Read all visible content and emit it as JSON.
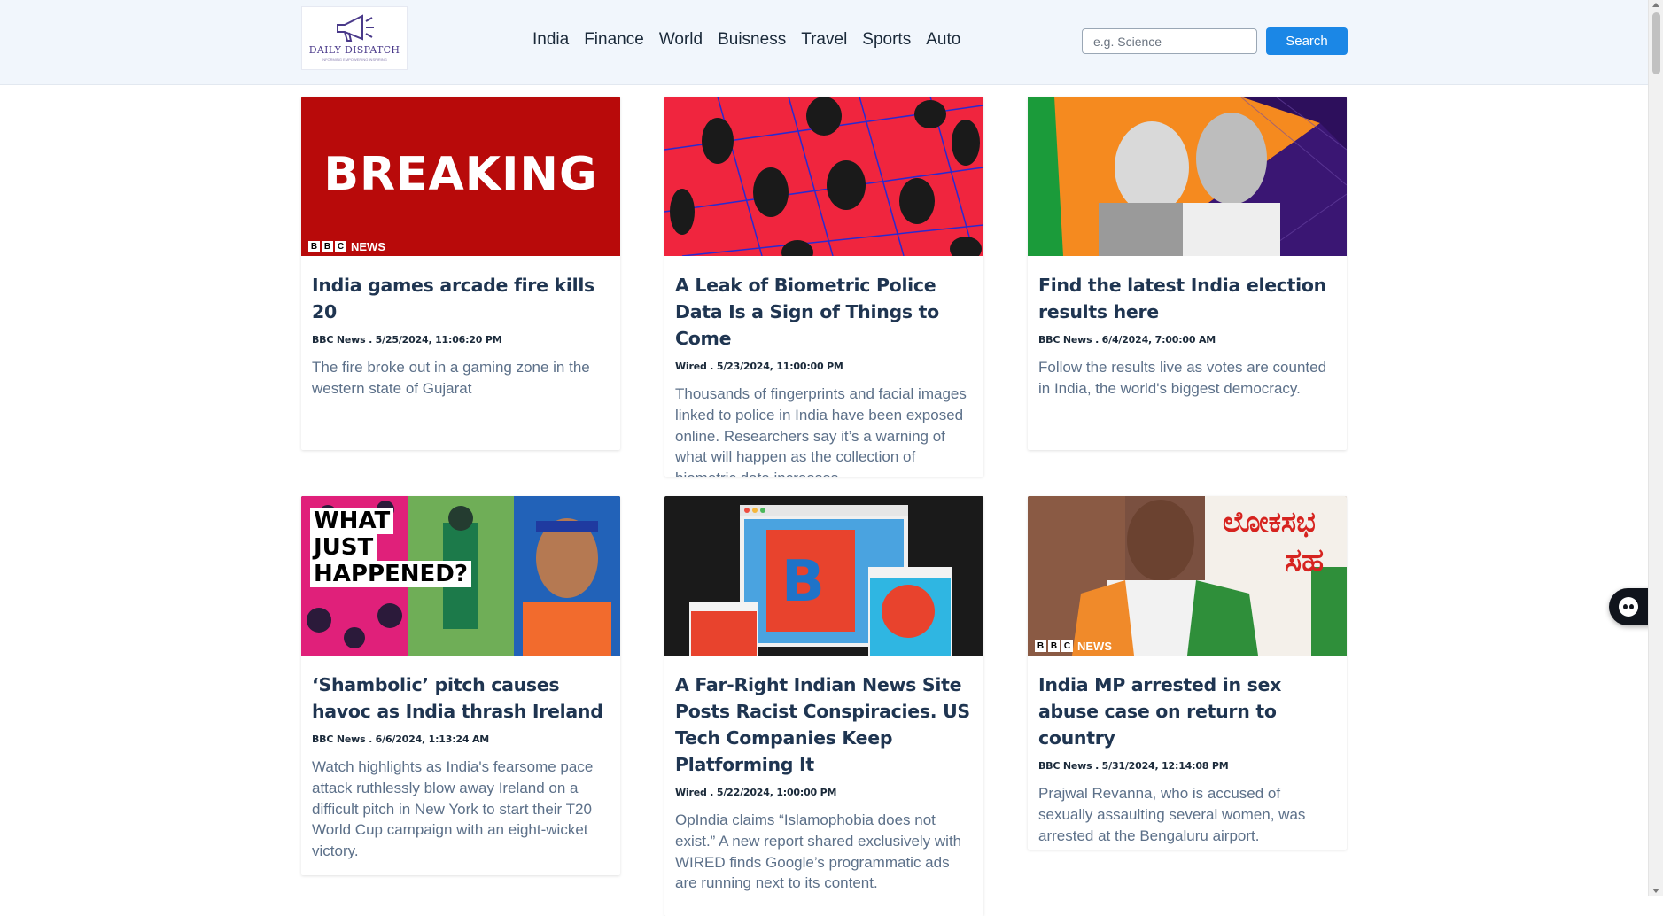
{
  "brand": {
    "name": "DAILY DISPATCH",
    "tagline": "INFORMING EMPOWERING INSPIRING"
  },
  "nav": {
    "links": [
      "India",
      "Finance",
      "World",
      "Buisness",
      "Travel",
      "Sports",
      "Auto"
    ]
  },
  "search": {
    "placeholder": "e.g. Science",
    "button_label": "Search"
  },
  "images": {
    "breaking_text": "BREAKING",
    "bbc_letters": [
      "B",
      "B",
      "C"
    ],
    "bbc_news_text": "NEWS",
    "what_happened_lines": [
      "WHAT",
      "JUST",
      "HAPPENED?"
    ],
    "b_logo": "B",
    "kannada_text": "ಲೋಕಸಭ",
    "kannada_text_2": "ಸಹ"
  },
  "articles": [
    {
      "title": "India games arcade fire kills 20",
      "meta": "BBC News . 5/25/2024, 11:06:20 PM",
      "description": "The fire broke out in a gaming zone in the western state of Gujarat"
    },
    {
      "title": "A Leak of Biometric Police Data Is a Sign of Things to Come",
      "meta": "Wired . 5/23/2024, 11:00:00 PM",
      "description": "Thousands of fingerprints and facial images linked to police in India have been exposed online. Researchers say it’s a warning of what will happen as the collection of biometric data increases."
    },
    {
      "title": "Find the latest India election results here",
      "meta": "BBC News . 6/4/2024, 7:00:00 AM",
      "description": "Follow the results live as votes are counted in India, the world's biggest democracy."
    },
    {
      "title": "‘Shambolic’ pitch causes havoc as India thrash Ireland",
      "meta": "BBC News . 6/6/2024, 1:13:24 AM",
      "description": "Watch highlights as India's fearsome pace attack ruthlessly blow away Ireland on a difficult pitch in New York to start their T20 World Cup campaign with an eight-wicket victory."
    },
    {
      "title": "A Far-Right Indian News Site Posts Racist Conspiracies. US Tech Companies Keep Platforming It",
      "meta": "Wired . 5/22/2024, 1:00:00 PM",
      "description": "OpIndia claims “Islamophobia does not exist.” A new report shared exclusively with WIRED finds Google’s programmatic ads are running next to its content."
    },
    {
      "title": "India MP arrested in sex abuse case on return to country",
      "meta": "BBC News . 5/31/2024, 12:14:08 PM",
      "description": "Prajwal Revanna, who is accused of sexually assaulting several women, was arrested at the Bengaluru airport."
    }
  ],
  "colors": {
    "accent": "#1b87e6",
    "navbar_bg": "#f1f6fc",
    "title": "#1f3551",
    "description": "#5c7089"
  }
}
